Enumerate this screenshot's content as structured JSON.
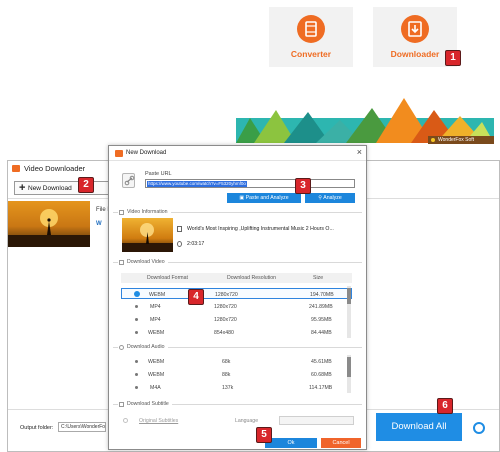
{
  "top_tiles": {
    "converter_label": "Converter",
    "downloader_label": "Downloader"
  },
  "banner": {
    "brand": "WonderFox Soft"
  },
  "badges": [
    "1",
    "2",
    "3",
    "4",
    "5",
    "6"
  ],
  "video_downloader": {
    "title": "Video Downloader",
    "new_download_label": "New Download",
    "file_name_label": "File N",
    "item_prefix": "W",
    "output_folder_label": "Output folder:",
    "output_folder_value": "C:\\Users\\WonderFox\\D",
    "download_all_label": "Download All"
  },
  "new_download": {
    "title": "New Download",
    "paste_url_label": "Paste URL",
    "url_value": "https://www.youtube.com/watch?v=F5320yhmf0o",
    "paste_analyze_label": "Paste and Analyze",
    "analyze_label": "Analyze",
    "video_info_label": "Video Information",
    "video_title": "World's Most Inspiring ,Uplifting Instrumental Music  2 Hours O...",
    "video_duration": "2:03:17",
    "download_video_label": "Download Video",
    "video_columns": {
      "format": "Download Format",
      "resolution": "Download Resolution",
      "size": "Size"
    },
    "video_rows": [
      {
        "format": "WEBM",
        "resolution": "1280x720",
        "size": "194.70MB"
      },
      {
        "format": "MP4",
        "resolution": "1280x720",
        "size": "241.89MB"
      },
      {
        "format": "MP4",
        "resolution": "1280x720",
        "size": "95.95MB"
      },
      {
        "format": "WEBM",
        "resolution": "854x480",
        "size": "84.44MB"
      }
    ],
    "download_audio_label": "Download Audio",
    "audio_rows": [
      {
        "format": "WEBM",
        "bitrate": "68k",
        "size": "45.61MB"
      },
      {
        "format": "WEBM",
        "bitrate": "88k",
        "size": "60.68MB"
      },
      {
        "format": "M4A",
        "bitrate": "137k",
        "size": "114.17MB"
      }
    ],
    "download_subtitle_label": "Download Subtitle",
    "original_subtitles_label": "Original Subtitles",
    "language_label": "Language",
    "ok_label": "Ok",
    "cancel_label": "Cancel"
  },
  "colors": {
    "accent_orange": "#ef6c23",
    "accent_blue": "#1f8de4",
    "badge_red": "#d8262b",
    "cancel_orange": "#f0642b"
  }
}
